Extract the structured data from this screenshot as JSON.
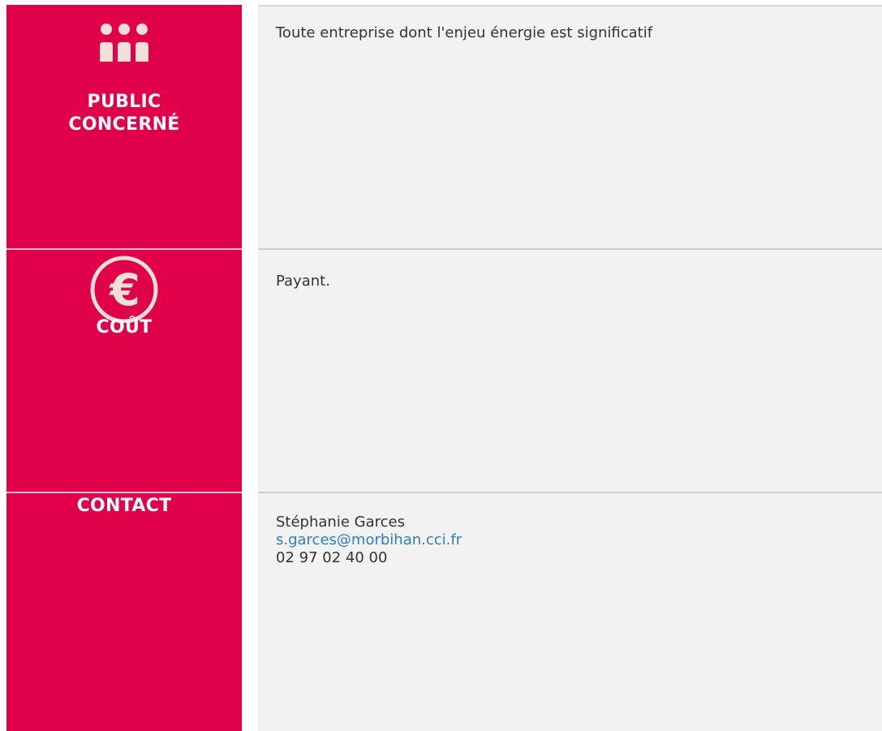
{
  "colors": {
    "label_bg": "#e1004a",
    "content_bg": "#f2f2f2",
    "icon_fill": "#f0e0d6",
    "link": "#2b7fc4"
  },
  "sections": [
    {
      "icon": "people-icon",
      "label_line1": "PUBLIC",
      "label_line2": "CONCERNÉ",
      "content": "Toute entreprise dont l'enjeu énergie est significatif"
    },
    {
      "icon": "euro-icon",
      "label": "COÛT",
      "content": "Payant."
    },
    {
      "label": "CONTACT",
      "contact": {
        "name": "Stéphanie Garces",
        "email": "s.garces@morbihan.cci.fr",
        "phone": "02 97 02 40 00"
      }
    }
  ]
}
